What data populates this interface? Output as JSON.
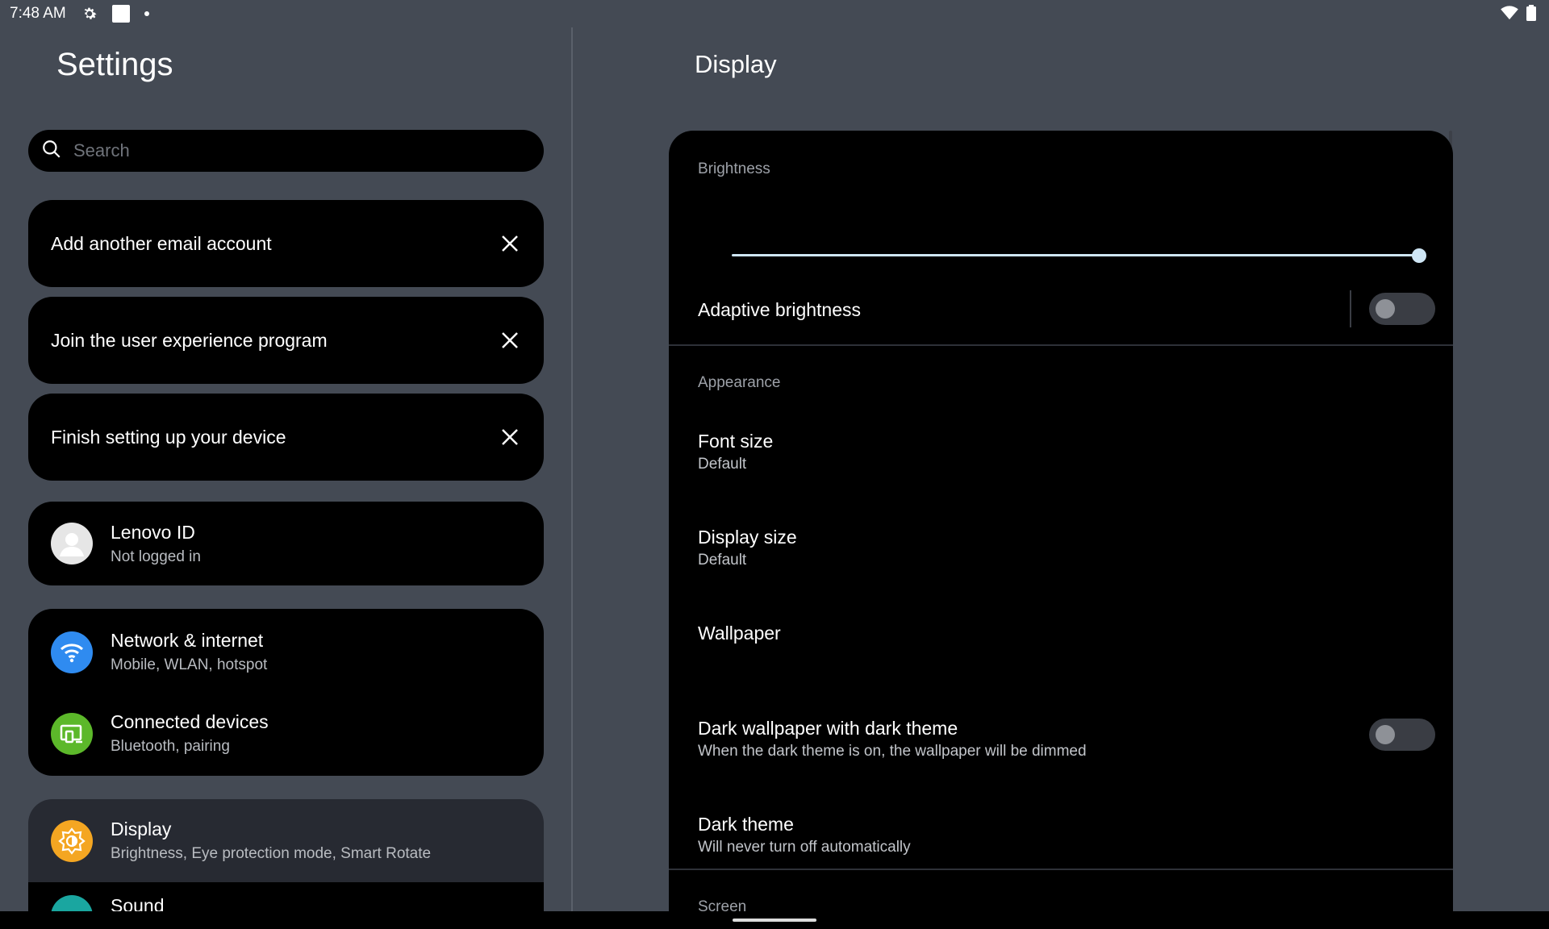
{
  "status_bar": {
    "time": "7:48 AM",
    "icons": [
      "gear-icon",
      "square-icon",
      "dot-icon"
    ],
    "right_icons": [
      "wifi-icon",
      "battery-icon"
    ]
  },
  "left": {
    "title": "Settings",
    "search": {
      "placeholder": "Search"
    },
    "suggestions": [
      {
        "label": "Add another email account"
      },
      {
        "label": "Join the user experience program"
      },
      {
        "label": "Finish setting up your device"
      }
    ],
    "account": {
      "title": "Lenovo ID",
      "subtitle": "Not logged in"
    },
    "network": {
      "title": "Network & internet",
      "subtitle": "Mobile, WLAN, hotspot",
      "color": "#2f8bf0"
    },
    "connected": {
      "title": "Connected devices",
      "subtitle": "Bluetooth, pairing",
      "color": "#5cb82a"
    },
    "display": {
      "title": "Display",
      "subtitle": "Brightness, Eye protection mode, Smart Rotate",
      "color": "#f4a622"
    },
    "partial": {
      "title": "Sound",
      "color": "#1aa6a0"
    }
  },
  "right": {
    "title": "Display",
    "brightness": {
      "header": "Brightness",
      "level": 1.0,
      "accent": "#cfe6f5"
    },
    "adaptive": {
      "label": "Adaptive brightness",
      "enabled": false
    },
    "appearance": {
      "header": "Appearance"
    },
    "font_size": {
      "title": "Font size",
      "value": "Default"
    },
    "display_size": {
      "title": "Display size",
      "value": "Default"
    },
    "wallpaper": {
      "title": "Wallpaper"
    },
    "dark_wallpaper": {
      "title": "Dark wallpaper with dark theme",
      "subtitle": "When the dark theme is on, the wallpaper will be dimmed",
      "enabled": false
    },
    "dark_theme": {
      "title": "Dark theme",
      "subtitle": "Will never turn off automatically"
    },
    "screen": {
      "header": "Screen"
    }
  }
}
